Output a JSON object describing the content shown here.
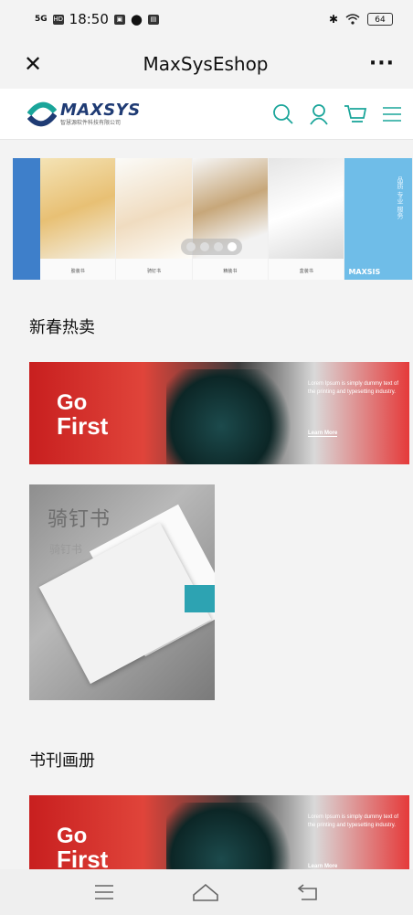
{
  "status": {
    "signal": "5G",
    "time": "18:50",
    "battery": "64"
  },
  "titlebar": {
    "close_icon": "close-icon",
    "title": "MaxSysEshop",
    "more_label": "···"
  },
  "site": {
    "brand": "MAXSYS",
    "brand_sub": "智慧源软件科技有限公司",
    "accent_color": "#1aa59a"
  },
  "banner": {
    "captions": [
      "胶装书",
      "骑钉书",
      "精装书",
      "盒装书"
    ],
    "brand": "MAXSIS",
    "vertical_text": "品质 专业 服务",
    "dots": 4,
    "active_dot": 4
  },
  "sections": [
    {
      "title": "新春热卖",
      "promo": {
        "headline_1": "Go",
        "headline_2": "First",
        "body": "Lorem Ipsum is simply dummy text of the printing and typesetting industry.",
        "cta": "Learn More"
      },
      "product": {
        "name": "骑钉书",
        "subname": "骑钉书"
      }
    },
    {
      "title": "书刊画册",
      "promo": {
        "headline_1": "Go",
        "headline_2": "First",
        "body": "Lorem Ipsum is simply dummy text of the printing and typesetting industry.",
        "cta": "Learn More"
      }
    }
  ],
  "navbar": {
    "menu": "menu-icon",
    "home": "home-icon",
    "back": "back-icon"
  }
}
